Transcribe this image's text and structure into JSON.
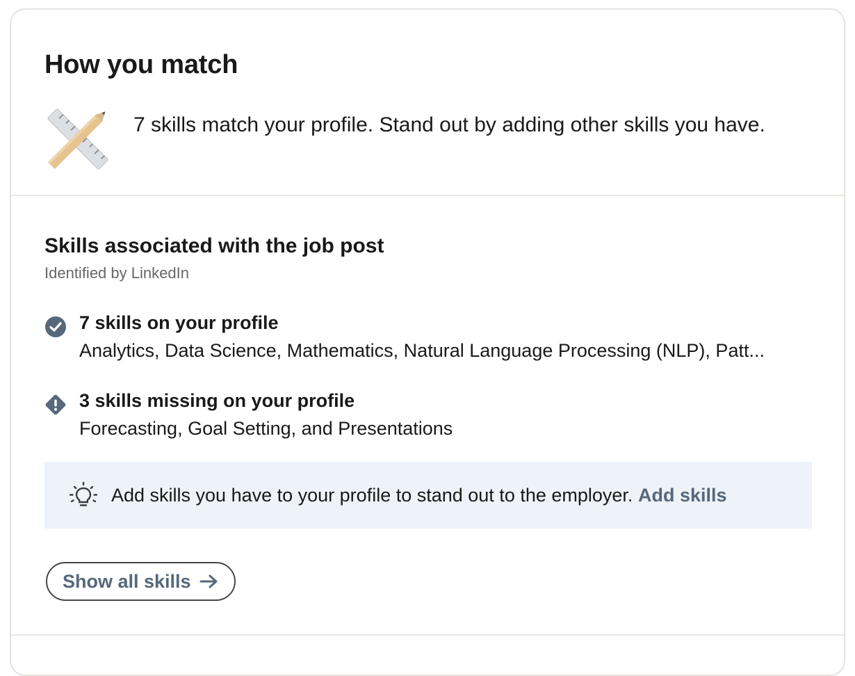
{
  "card": {
    "title": "How you match",
    "match_summary": "7 skills match your profile. Stand out by adding other skills you have."
  },
  "skills_section": {
    "title": "Skills associated with the job post",
    "subtitle": "Identified by LinkedIn",
    "groups": [
      {
        "icon": "check-circle-icon",
        "title": "7 skills on your profile",
        "skills": "Analytics, Data Science, Mathematics, Natural Language Processing (NLP), Patt..."
      },
      {
        "icon": "warning-diamond-icon",
        "title": "3 skills missing on your profile",
        "skills": "Forecasting, Goal Setting, and Presentations"
      }
    ]
  },
  "tip": {
    "icon": "lightbulb-icon",
    "text": "Add skills you have to your profile to stand out to the employer.",
    "link_label": "Add skills"
  },
  "actions": {
    "show_all_label": "Show all skills",
    "show_all_icon": "arrow-right-icon"
  },
  "colors": {
    "link": "#56687a",
    "tip_background": "#edf3f8",
    "icon_dark": "#56687a",
    "divider": "#e9e7e4"
  }
}
